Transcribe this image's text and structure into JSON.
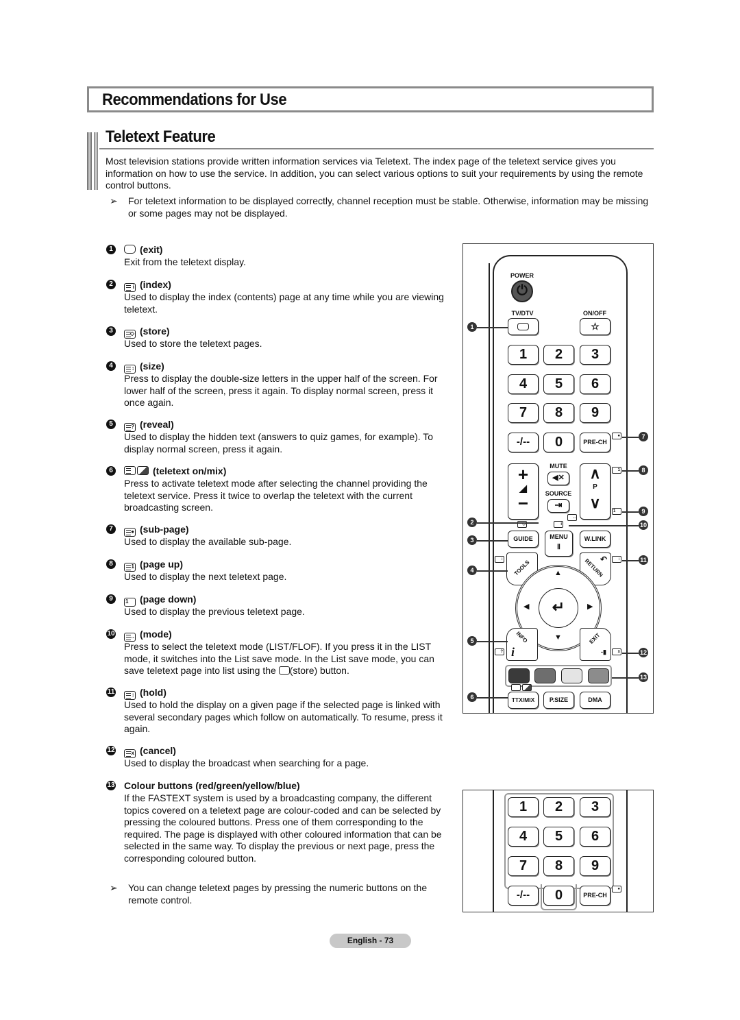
{
  "section_title": "Recommendations for Use",
  "feature_title": "Teletext Feature",
  "intro": "Most television stations provide written information services via Teletext. The index page of the teletext service gives you information on how to use the service. In addition, you can select various options to suit your requirements by using the remote control buttons.",
  "notes": [
    {
      "arrow": "➢",
      "text": "For teletext information to be displayed correctly, channel reception must be stable. Otherwise, information may be missing or some pages may not be displayed."
    },
    {
      "arrow": "➢",
      "text": "You can change teletext pages by pressing the numeric buttons on the remote control."
    }
  ],
  "items": [
    {
      "num": "1",
      "icon": "exit-icon",
      "icon_glyph": "",
      "title": "(exit)",
      "desc": "Exit from the teletext display."
    },
    {
      "num": "2",
      "icon": "index-icon",
      "icon_glyph": "i",
      "title": "(index)",
      "desc": "Used to display the index (contents) page at any time while you are viewing teletext."
    },
    {
      "num": "3",
      "icon": "store-icon",
      "icon_glyph": "◇",
      "title": "(store)",
      "desc": "Used to store the teletext pages."
    },
    {
      "num": "4",
      "icon": "size-icon",
      "icon_glyph": "↕",
      "title": "(size)",
      "desc": "Press to display the double-size letters in the upper half of the screen. For lower half of the screen, press it again. To display normal screen, press it once again."
    },
    {
      "num": "5",
      "icon": "reveal-icon",
      "icon_glyph": "?",
      "title": "(reveal)",
      "desc": "Used to display the hidden text (answers to quiz games, for example). To display normal screen, press it again."
    },
    {
      "num": "6",
      "icon": "teletext-mix-icon",
      "icon_glyph": "",
      "title": "(teletext on/mix)",
      "desc": "Press to activate teletext mode after selecting the channel providing the teletext service. Press it twice to overlap the teletext with the current broadcasting screen."
    },
    {
      "num": "7",
      "icon": "sub-page-icon",
      "icon_glyph": "●",
      "title": "(sub-page)",
      "desc": "Used to display the available sub-page."
    },
    {
      "num": "8",
      "icon": "page-up-icon",
      "icon_glyph": "1",
      "title": "(page up)",
      "desc": "Used to display the next teletext page."
    },
    {
      "num": "9",
      "icon": "page-down-icon",
      "icon_glyph": "1",
      "title": "(page down)",
      "desc": "Used to display the previous teletext page."
    },
    {
      "num": "10",
      "icon": "mode-icon",
      "icon_glyph": "..",
      "title": "(mode)",
      "desc_before": "Press to select the teletext mode (LIST/FLOF). If you press it in the LIST mode, it switches into the List save mode. In the List save mode, you can save teletext page into list using the ",
      "desc_after": "(store) button."
    },
    {
      "num": "11",
      "icon": "hold-icon",
      "icon_glyph": "↕",
      "title": "(hold)",
      "desc": "Used to hold the display on a given page if the selected page is linked with several secondary pages which follow on automatically. To resume, press it again."
    },
    {
      "num": "12",
      "icon": "cancel-icon",
      "icon_glyph": "x",
      "title": "(cancel)",
      "desc": "Used to display the broadcast when searching for a page."
    },
    {
      "num": "13",
      "icon": "",
      "icon_glyph": "",
      "title": "Colour buttons (red/green/yellow/blue)",
      "desc": "If the FASTEXT system is used by a broadcasting company, the different topics covered on a teletext page are colour-coded and can be selected by pressing the coloured buttons. Press one of them corresponding to the required. The page is displayed with other coloured information that can be selected in the same way. To display the previous or next page, press the corresponding coloured button."
    }
  ],
  "remote": {
    "power_label": "POWER",
    "power_glyph": "⏻",
    "tvdtv_label": "TV/DTV",
    "onoff_label": "ON/OFF",
    "onoff_glyph": "☆",
    "digits": [
      "1",
      "2",
      "3",
      "4",
      "5",
      "6",
      "7",
      "8",
      "9"
    ],
    "dash_label": "-/--",
    "zero_label": "0",
    "prech_label": "PRE-CH",
    "mute_label": "MUTE",
    "mute_glyph": "🔇",
    "source_label": "SOURCE",
    "source_glyph": "⇥",
    "vol_plus": "+",
    "vol_minus": "−",
    "vol_glyph": "◢",
    "ch_up": "∧",
    "ch_down": "∨",
    "ch_label": "P",
    "guide_label": "GUIDE",
    "menu_label": "MENU",
    "menu_glyph": "Ⅱ",
    "wlink_label": "W.LINK",
    "tools_label": "TOOLS",
    "return_label": "RETURN",
    "return_glyph": "↶",
    "info_label": "INFO",
    "info_glyph": "i",
    "exit_label": "EXIT",
    "enter_glyph": "↵",
    "up": "▲",
    "down": "▼",
    "left": "◀",
    "right": "▶",
    "color_buttons": [
      {
        "name": "red",
        "color": "#3a3a3a"
      },
      {
        "name": "green",
        "color": "#6e6e6e"
      },
      {
        "name": "yellow",
        "color": "#e4e4e4"
      },
      {
        "name": "blue",
        "color": "#8c8c8c"
      }
    ],
    "ttxmix_label": "TTX/MIX",
    "psize_label": "P.SIZE",
    "dma_label": "DMA",
    "callouts": [
      "1",
      "2",
      "3",
      "4",
      "5",
      "6",
      "7",
      "8",
      "9",
      "10",
      "11",
      "12",
      "13"
    ]
  },
  "footer": "English - 73"
}
